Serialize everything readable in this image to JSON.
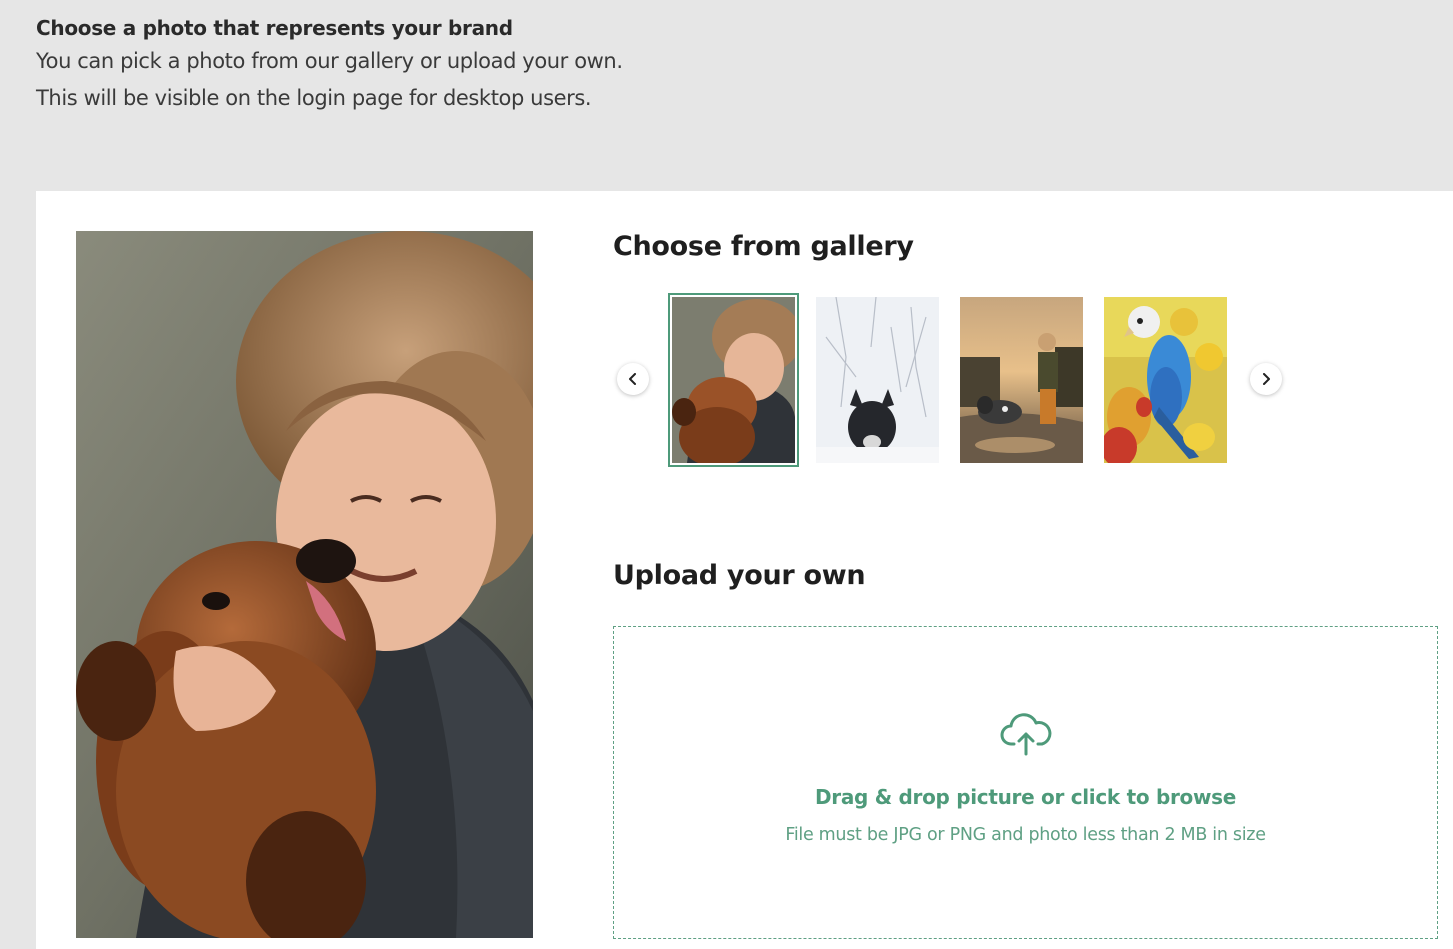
{
  "intro": {
    "title": "Choose a photo that represents your brand",
    "line1": "You can pick a photo from our gallery or upload your own.",
    "line2": "This will be visible on the login page for desktop users."
  },
  "gallery": {
    "title": "Choose from gallery",
    "selected_index": 0,
    "thumbnails": [
      "woman-with-dog-photo",
      "dog-in-snow-photo",
      "child-with-dog-photo",
      "parrots-photo"
    ]
  },
  "upload": {
    "title": "Upload your own",
    "main_text": "Drag & drop picture or click to browse",
    "sub_text": "File must be JPG or PNG and photo less than 2 MB in size",
    "icon": "cloud-upload-icon"
  },
  "colors": {
    "accent": "#4e9a7a",
    "background": "#e6e6e6",
    "card": "#ffffff"
  }
}
